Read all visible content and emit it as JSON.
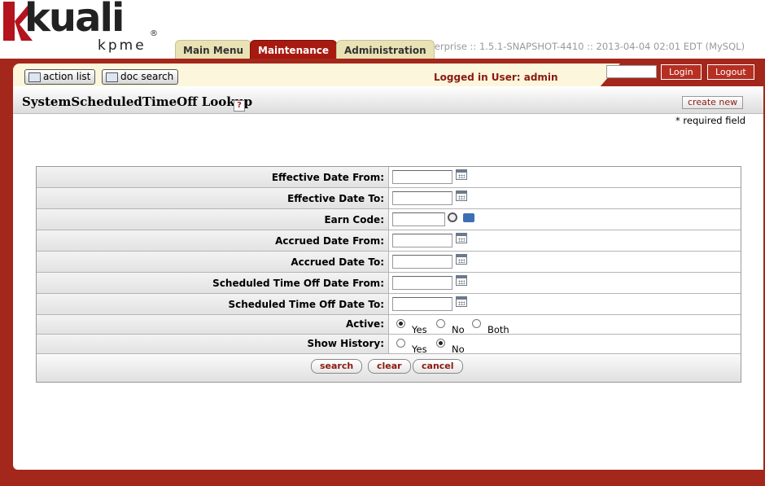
{
  "app": {
    "logo_text": "kuali",
    "logo_sub": "kpme",
    "registered": "®",
    "build_info": "nterprise :: 1.5.1-SNAPSHOT-4410 :: 2013-04-04 02:01 EDT (MySQL)"
  },
  "tabs": [
    {
      "label": "Main Menu"
    },
    {
      "label": "Maintenance"
    },
    {
      "label": "Administration"
    }
  ],
  "nav": {
    "action_list": "action list",
    "doc_search": "doc search",
    "logged_in": "Logged in User: admin",
    "login": "Login",
    "logout": "Logout",
    "login_value": ""
  },
  "page": {
    "title": "SystemScheduledTimeOff Lookup",
    "help": "?",
    "create_new": "create new",
    "required_note": "* required field"
  },
  "form": {
    "fields": [
      {
        "label": "Effective Date From:"
      },
      {
        "label": "Effective Date To:"
      },
      {
        "label": "Earn Code:"
      },
      {
        "label": "Accrued Date From:"
      },
      {
        "label": "Accrued Date To:"
      },
      {
        "label": "Scheduled Time Off Date From:"
      },
      {
        "label": "Scheduled Time Off Date To:"
      }
    ],
    "active": {
      "label": "Active:",
      "options": [
        "Yes",
        "No",
        "Both"
      ],
      "selected": "Yes"
    },
    "history": {
      "label": "Show History:",
      "options": [
        "Yes",
        "No"
      ],
      "selected": "No"
    },
    "buttons": {
      "search": "search",
      "clear": "clear",
      "cancel": "cancel"
    }
  }
}
